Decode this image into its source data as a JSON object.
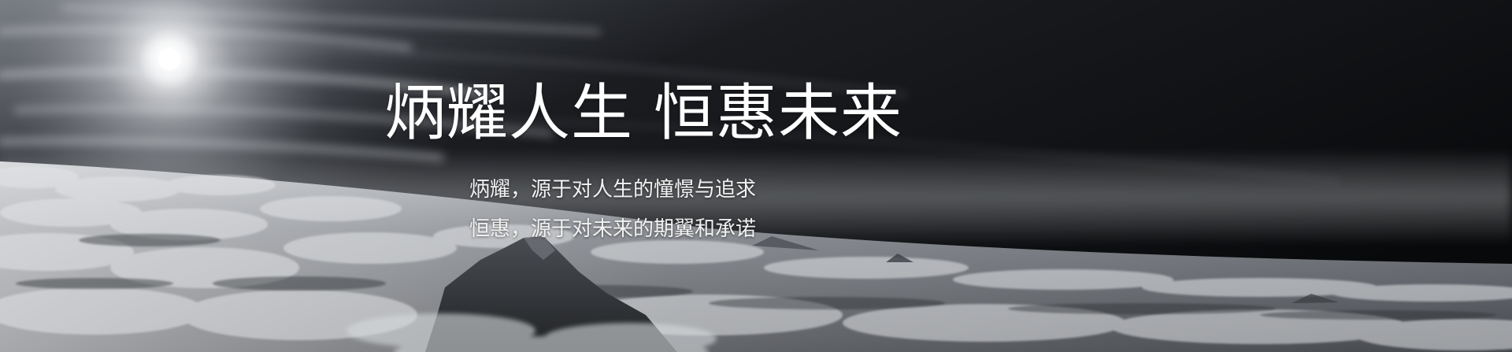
{
  "hero": {
    "title_part1": "炳耀人生",
    "title_part2": "恒惠未来",
    "line1": "炳耀，源于对人生的憧憬与追求",
    "line2": "恒惠，源于对未来的期翼和承诺"
  },
  "colors": {
    "sky_dark": "#0b0c0e",
    "sky_light": "#e6e8ec",
    "cloud": "#cfd2d6",
    "text": "#ffffff"
  }
}
